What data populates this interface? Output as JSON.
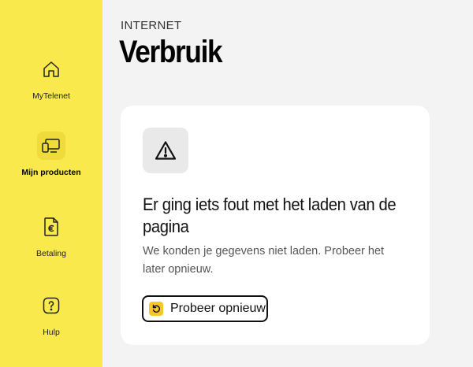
{
  "sidebar": {
    "items": [
      {
        "label": "MyTelenet",
        "icon": "home-icon",
        "active": false
      },
      {
        "label": "Mijn producten",
        "icon": "devices-icon",
        "active": true
      },
      {
        "label": "Betaling",
        "icon": "euro-document-icon",
        "active": false
      },
      {
        "label": "Hulp",
        "icon": "question-icon",
        "active": false
      }
    ],
    "background": "#f9e94c"
  },
  "header": {
    "section": "INTERNET",
    "title": "Verbruik"
  },
  "error_card": {
    "icon": "warning-icon",
    "heading": "Er ging iets fout met het laden van de pagina",
    "message": "We konden je gegevens niet laden. Probeer het later opnieuw.",
    "retry_label": "Probeer opnieuw",
    "retry_icon": "retry-icon",
    "accent": "#f6c827"
  }
}
